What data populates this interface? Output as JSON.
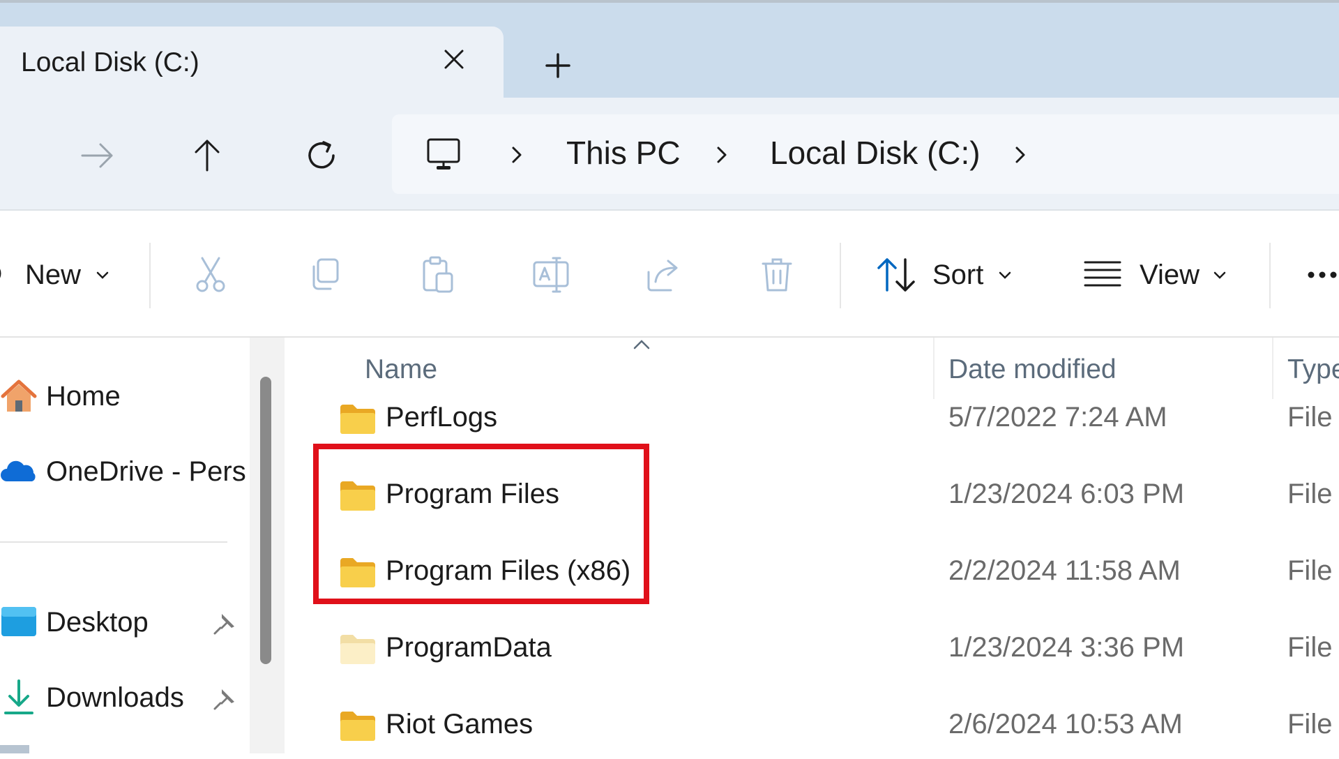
{
  "tab": {
    "title": "Local Disk (C:)"
  },
  "address": {
    "crumbs": [
      "This PC",
      "Local Disk (C:)"
    ]
  },
  "commands": {
    "new_label": "New",
    "sort_label": "Sort",
    "view_label": "View"
  },
  "nav_pane": {
    "items": [
      {
        "label": "Home",
        "icon": "home-icon"
      },
      {
        "label": "OneDrive - Perso",
        "icon": "onedrive-icon"
      },
      {
        "label": "Desktop",
        "icon": "desktop-folder-icon",
        "pinned": true
      },
      {
        "label": "Downloads",
        "icon": "downloads-icon",
        "pinned": true
      }
    ]
  },
  "columns": {
    "name": "Name",
    "date": "Date modified",
    "type": "Type"
  },
  "files": [
    {
      "name": "PerfLogs",
      "date": "5/7/2022 7:24 AM",
      "type": "File"
    },
    {
      "name": "Program Files",
      "date": "1/23/2024 6:03 PM",
      "type": "File"
    },
    {
      "name": "Program Files (x86)",
      "date": "2/2/2024 11:58 AM",
      "type": "File"
    },
    {
      "name": "ProgramData",
      "date": "1/23/2024 3:36 PM",
      "type": "File"
    },
    {
      "name": "Riot Games",
      "date": "2/6/2024 10:53 AM",
      "type": "File"
    }
  ],
  "colors": {
    "highlight": "#e0101a",
    "folder": "#f5c542",
    "accent": "#0067c0",
    "tabstrip": "#cbdcec"
  }
}
